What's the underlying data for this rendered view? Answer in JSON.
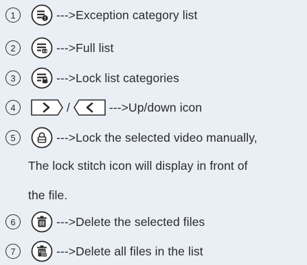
{
  "items": [
    {
      "num": "1",
      "icon": "exception-list-icon",
      "text": "--->Exception category list"
    },
    {
      "num": "2",
      "icon": "full-list-icon",
      "text": "--->Full list"
    },
    {
      "num": "3",
      "icon": "lock-list-icon",
      "text": "--->Lock list categories"
    },
    {
      "num": "4",
      "icon": "up-down-icon",
      "slash": "/",
      "text": "--->Up/down icon"
    },
    {
      "num": "5",
      "icon": "lock-icon",
      "text": "--->Lock the selected video manually,",
      "cont": [
        "The lock stitch icon will display in front of",
        "the file."
      ]
    },
    {
      "num": "6",
      "icon": "delete-selected-icon",
      "text": "--->Delete the selected files"
    },
    {
      "num": "7",
      "icon": "delete-all-icon",
      "text": "--->Delete all files in the list"
    }
  ]
}
